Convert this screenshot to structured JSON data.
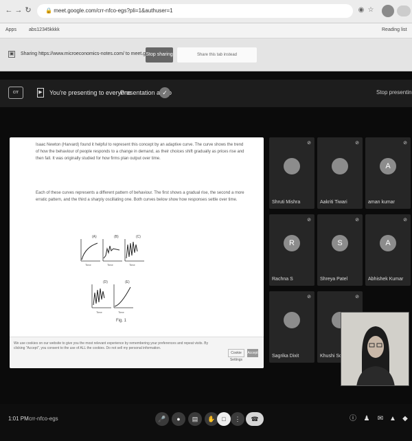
{
  "browser": {
    "url": "meet.google.com/crr-nfco-egs?pli=1&authuser=1",
    "bookmarks": [
      "Apps",
      "abs12345kkkk"
    ],
    "reading_list": "Reading list"
  },
  "share_bar": {
    "text": "Sharing https://www.microeconomics-notes.com/ to meet.google.com",
    "stop_button": "Stop sharing",
    "share_tab_button": "Share this tab instead"
  },
  "meet": {
    "meet_code_label": "crr",
    "presenting_text": "You're presenting to everyone",
    "presentation_audio": "Presentation audio",
    "stop_presenting": "Stop presenting",
    "document": {
      "paragraph1": "Isaac Newton (Harvard) found it helpful to represent this concept by an adaptive curve. The curve shows the trend of how the behaviour of people responds to a change in demand, as their choices shift gradually as prices rise and then fall. It was originally studied for how firms plan output over time.",
      "paragraph2": "Each of these curves represents a different pattern of behaviour. The first shows a gradual rise, the second a more erratic pattern, and the third a sharply oscillating one. Both curves below show how responses settle over time.",
      "graph_label_1": "(A)",
      "graph_label_2": "(B)",
      "graph_label_3": "(C)",
      "graph_label_4": "(D)",
      "graph_label_5": "(E)",
      "axis_label": "Time",
      "figure_caption": "Fig. 1",
      "cookie_text": "We use cookies on our website to give you the most relevant experience by remembering your preferences and repeat visits. By clicking \"Accept\", you consent to the use of ALL the cookies. Do not sell my personal information.",
      "cookie_settings": "Cookie Settings",
      "cookie_accept": "Accept"
    },
    "participants": [
      {
        "initial": "",
        "name": "Shruti Mishra"
      },
      {
        "initial": "",
        "name": "Aakriti Tiwari"
      },
      {
        "initial": "A",
        "name": "aman kumar"
      },
      {
        "initial": "R",
        "name": "Rachna S"
      },
      {
        "initial": "S",
        "name": "Shreya Patel"
      },
      {
        "initial": "A",
        "name": "Abhishek Kumar"
      },
      {
        "initial": "",
        "name": "Sagrika Dixit"
      },
      {
        "initial": "",
        "name": "Khushi Sonu"
      }
    ],
    "toolbar": {
      "time": "1:01 PM",
      "meeting_code": "crr-nfco-egs"
    }
  },
  "colors": {
    "meet_bg": "#0b0b0b",
    "tile_bg": "#262626",
    "present_bar": "#1d1d1d"
  }
}
